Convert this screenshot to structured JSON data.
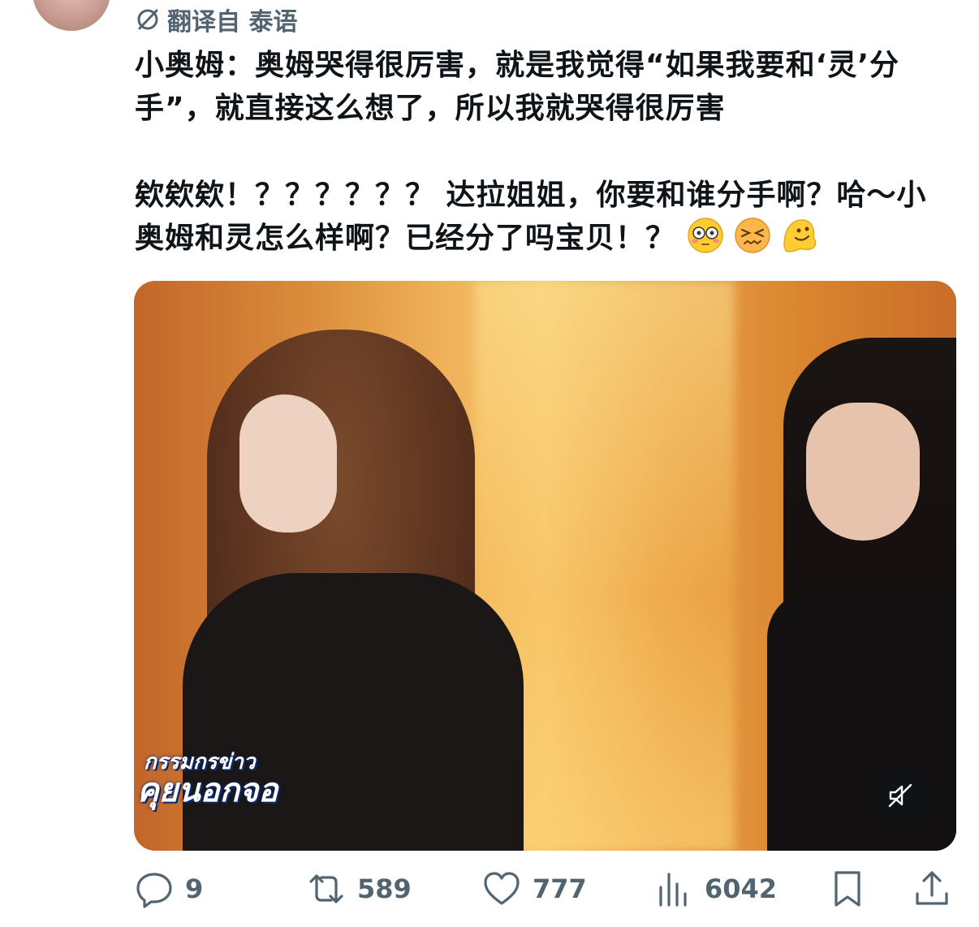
{
  "tweet": {
    "translated_from": "翻译自 泰语",
    "text_paragraph1": "小奥姆：奥姆哭得很厉害，就是我觉得“如果我要和‘灵’分手”，就直接这么想了，所以我就哭得很厉害",
    "text_paragraph2": "欸欸欸！？？？？？？ 达拉姐姐，你要和谁分手啊？哈～小奥姆和灵怎么样啊？已经分了吗宝贝！？",
    "emojis": [
      "flushed-face",
      "confounded-face",
      "melting-face"
    ]
  },
  "media": {
    "caption_line1": "กรรมกรข่าว",
    "caption_line2": "คุยนอกจอ",
    "muted": true
  },
  "actions": {
    "replies": "9",
    "reposts": "589",
    "likes": "777",
    "views": "6042"
  },
  "colors": {
    "text": "#0f1419",
    "secondary": "#536471"
  }
}
